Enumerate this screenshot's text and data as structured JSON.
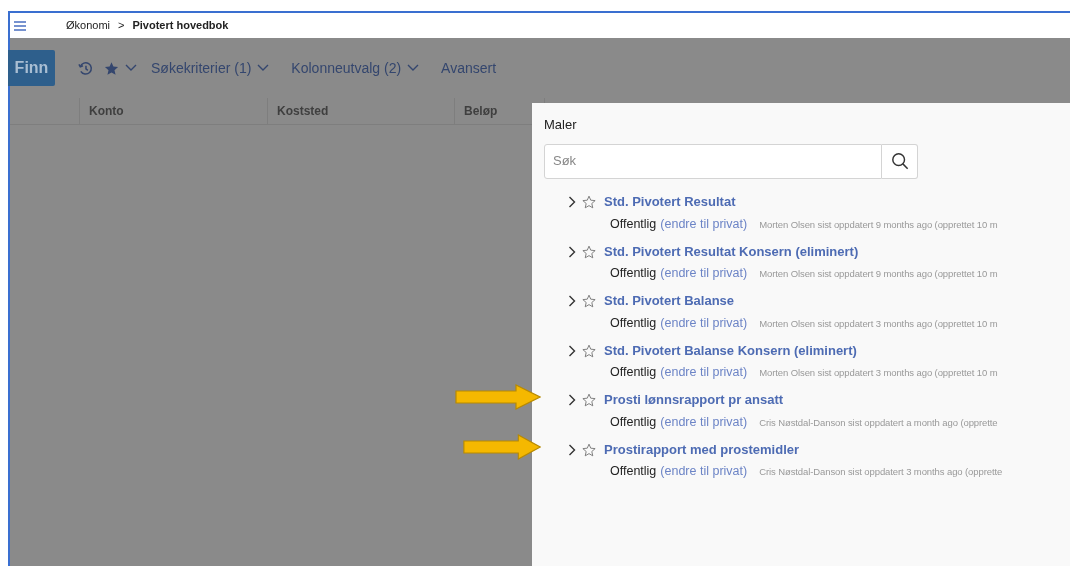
{
  "breadcrumb": {
    "items": [
      "Økonomi",
      "Pivotert hovedbok"
    ],
    "separator": ">"
  },
  "toolbar": {
    "primary_button": "Finn",
    "menus": [
      {
        "label": "Søkekriterier (1)",
        "dropdown": true
      },
      {
        "label": "Kolonneutvalg (2)",
        "dropdown": true
      },
      {
        "label": "Avansert",
        "dropdown": false
      }
    ]
  },
  "table": {
    "columns": [
      "Konto",
      "Koststed",
      "Beløp"
    ]
  },
  "templates_panel": {
    "title": "Maler",
    "search": {
      "placeholder": "Søk"
    },
    "items": [
      {
        "title": "Std. Pivotert Resultat",
        "visibility": "Offentlig",
        "action": "(endre til privat)",
        "meta": "Morten Olsen sist oppdatert 9 months ago (opprettet 10 m",
        "starred": false,
        "annotated": false
      },
      {
        "title": "Std. Pivotert Resultat Konsern (eliminert)",
        "visibility": "Offentlig",
        "action": "(endre til privat)",
        "meta": "Morten Olsen sist oppdatert 9 months ago (opprettet 10 m",
        "starred": false,
        "annotated": false
      },
      {
        "title": "Std. Pivotert Balanse",
        "visibility": "Offentlig",
        "action": "(endre til privat)",
        "meta": "Morten Olsen sist oppdatert 3 months ago (opprettet 10 m",
        "starred": false,
        "annotated": false
      },
      {
        "title": "Std. Pivotert Balanse Konsern (eliminert)",
        "visibility": "Offentlig",
        "action": "(endre til privat)",
        "meta": "Morten Olsen sist oppdatert 3 months ago (opprettet 10 m",
        "starred": false,
        "annotated": false
      },
      {
        "title": "Prosti lønnsrapport pr ansatt",
        "visibility": "Offentlig",
        "action": "(endre til privat)",
        "meta": "Cris Nøstdal-Danson sist oppdatert a month ago (opprette",
        "starred": false,
        "annotated": true
      },
      {
        "title": "Prostirapport med prostemidler",
        "visibility": "Offentlig",
        "action": "(endre til privat)",
        "meta": "Cris Nøstdal-Danson sist oppdatert 3 months ago (opprette",
        "starred": false,
        "annotated": true
      }
    ]
  }
}
